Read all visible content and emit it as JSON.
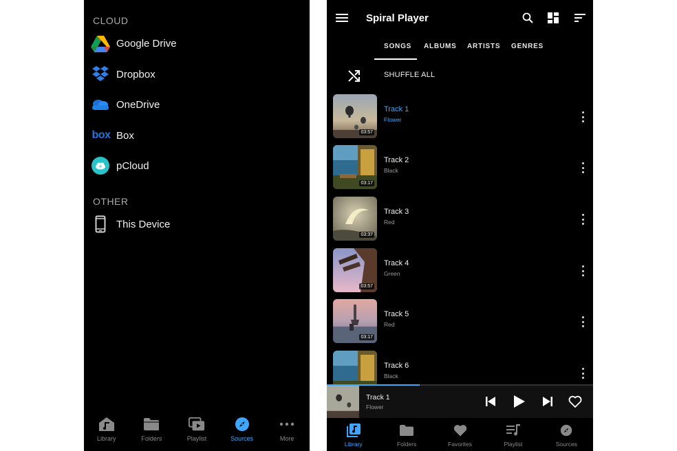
{
  "left": {
    "cloud_header": "CLOUD",
    "cloud_items": [
      {
        "label": "Google Drive",
        "icon": "google-drive-icon"
      },
      {
        "label": "Dropbox",
        "icon": "dropbox-icon"
      },
      {
        "label": "OneDrive",
        "icon": "onedrive-icon"
      },
      {
        "label": "Box",
        "icon": "box-icon"
      },
      {
        "label": "pCloud",
        "icon": "pcloud-icon"
      }
    ],
    "other_header": "OTHER",
    "other_items": [
      {
        "label": "This Device",
        "icon": "phone-icon"
      }
    ],
    "nav": [
      {
        "label": "Library",
        "icon": "library-icon",
        "active": false
      },
      {
        "label": "Folders",
        "icon": "folder-icon",
        "active": false
      },
      {
        "label": "Playlist",
        "icon": "playlist-icon",
        "active": false
      },
      {
        "label": "Sources",
        "icon": "compass-icon",
        "active": true
      },
      {
        "label": "More",
        "icon": "more-horizontal-icon",
        "active": false
      }
    ]
  },
  "right": {
    "title": "Spiral Player",
    "tabs": [
      "SONGS",
      "ALBUMS",
      "ARTISTS",
      "GENRES"
    ],
    "active_tab": "SONGS",
    "shuffle_label": "SHUFFLE ALL",
    "tracks": [
      {
        "title": "Track 1",
        "subtitle": "Flower",
        "duration": "03:57",
        "active": true
      },
      {
        "title": "Track 2",
        "subtitle": "Black",
        "duration": "03:17",
        "active": false
      },
      {
        "title": "Track 3",
        "subtitle": "Red",
        "duration": "03:37",
        "active": false
      },
      {
        "title": "Track 4",
        "subtitle": "Green",
        "duration": "03:57",
        "active": false
      },
      {
        "title": "Track 5",
        "subtitle": "Red",
        "duration": "03:17",
        "active": false
      },
      {
        "title": "Track 6",
        "subtitle": "Black",
        "duration": "",
        "active": false
      }
    ],
    "now_playing": {
      "title": "Track 1",
      "subtitle": "Flower",
      "progress": 0.35
    },
    "nav": [
      {
        "label": "Library",
        "icon": "library-icon",
        "active": true
      },
      {
        "label": "Folders",
        "icon": "folder-icon",
        "active": false
      },
      {
        "label": "Favorites",
        "icon": "heart-icon",
        "active": false
      },
      {
        "label": "Playlist",
        "icon": "playlist-icon",
        "active": false
      },
      {
        "label": "Sources",
        "icon": "compass-icon",
        "active": false
      }
    ],
    "colors": {
      "accent": "#3ea6ff",
      "background": "#000000"
    }
  }
}
